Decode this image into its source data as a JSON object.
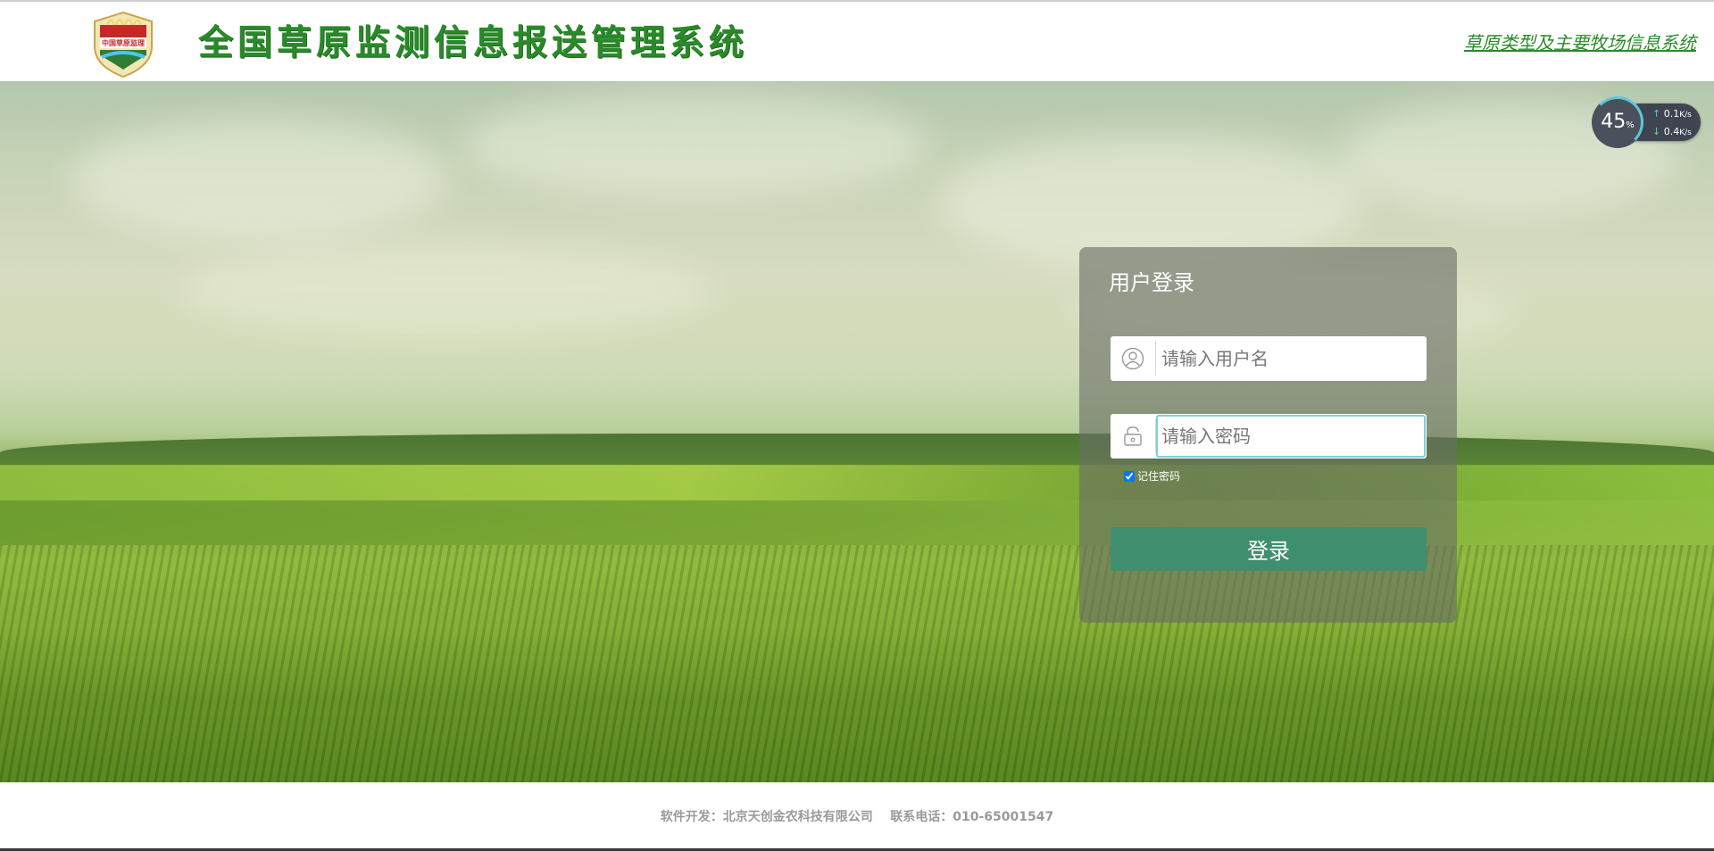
{
  "header": {
    "logo_text": "中国草原监理",
    "title": "全国草原监测信息报送管理系统",
    "top_link": "草原类型及主要牧场信息系统"
  },
  "net_widget": {
    "percent": "45",
    "percent_unit": "%",
    "upload": "0.1",
    "download": "0.4",
    "unit": "K/s"
  },
  "login": {
    "title": "用户登录",
    "username_placeholder": "请输入用户名",
    "password_placeholder": "请输入密码",
    "remember_label": "记住密码",
    "remember_checked": true,
    "submit_label": "登录"
  },
  "footer": {
    "text": "软件开发：北京天创金农科技有限公司    联系电话：010-65001547"
  },
  "colors": {
    "brand_green": "#2a8a2a",
    "button": "#3f8f6e"
  }
}
